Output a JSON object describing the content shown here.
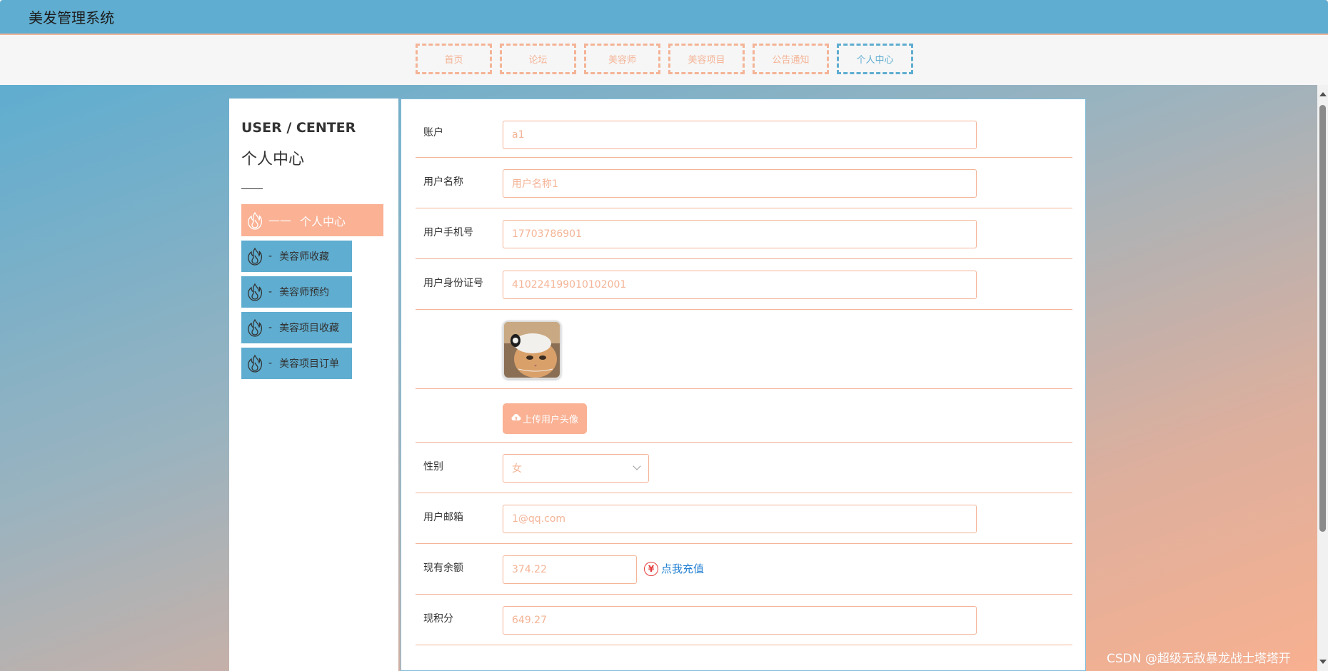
{
  "app": {
    "title": "美发管理系统"
  },
  "nav": {
    "items": [
      {
        "label": "首页",
        "active": false
      },
      {
        "label": "论坛",
        "active": false
      },
      {
        "label": "美容师",
        "active": false
      },
      {
        "label": "美容项目",
        "active": false
      },
      {
        "label": "公告通知",
        "active": false
      },
      {
        "label": "个人中心",
        "active": true
      }
    ]
  },
  "sidebar": {
    "title_en": "USER / CENTER",
    "title_cn": "个人中心",
    "items": [
      {
        "label": "个人中心",
        "dash": "——",
        "icon": "fire-icon",
        "active": true
      },
      {
        "label": "美容师收藏",
        "dash": "-",
        "icon": "fire-icon",
        "active": false
      },
      {
        "label": "美容师预约",
        "dash": "-",
        "icon": "fire-icon",
        "active": false
      },
      {
        "label": "美容项目收藏",
        "dash": "-",
        "icon": "fire-icon",
        "active": false
      },
      {
        "label": "美容项目订单",
        "dash": "-",
        "icon": "fire-icon",
        "active": false
      }
    ]
  },
  "form": {
    "account": {
      "label": "账户",
      "value": "a1"
    },
    "username": {
      "label": "用户名称",
      "value": "用户名称1"
    },
    "phone": {
      "label": "用户手机号",
      "value": "17703786901"
    },
    "id_card": {
      "label": "用户身份证号",
      "value": "410224199010102001"
    },
    "avatar": {
      "alt": "用户头像"
    },
    "upload": {
      "label": "上传用户头像",
      "icon": "cloud-upload-icon"
    },
    "gender": {
      "label": "性别",
      "value": "女"
    },
    "email": {
      "label": "用户邮箱",
      "value": "1@qq.com"
    },
    "balance": {
      "label": "现有余额",
      "value": "374.22",
      "recharge_label": "点我充值",
      "icon": "yen-icon",
      "icon_text": "¥"
    },
    "points": {
      "label": "现积分",
      "value": "649.27"
    }
  },
  "watermark": "CSDN @超级无敌暴龙战士塔塔开",
  "colors": {
    "primary": "#5fadd0",
    "accent": "#f4b497",
    "active_bg": "#fab194",
    "link": "#1f7ed1",
    "yen": "#e33b3b"
  }
}
